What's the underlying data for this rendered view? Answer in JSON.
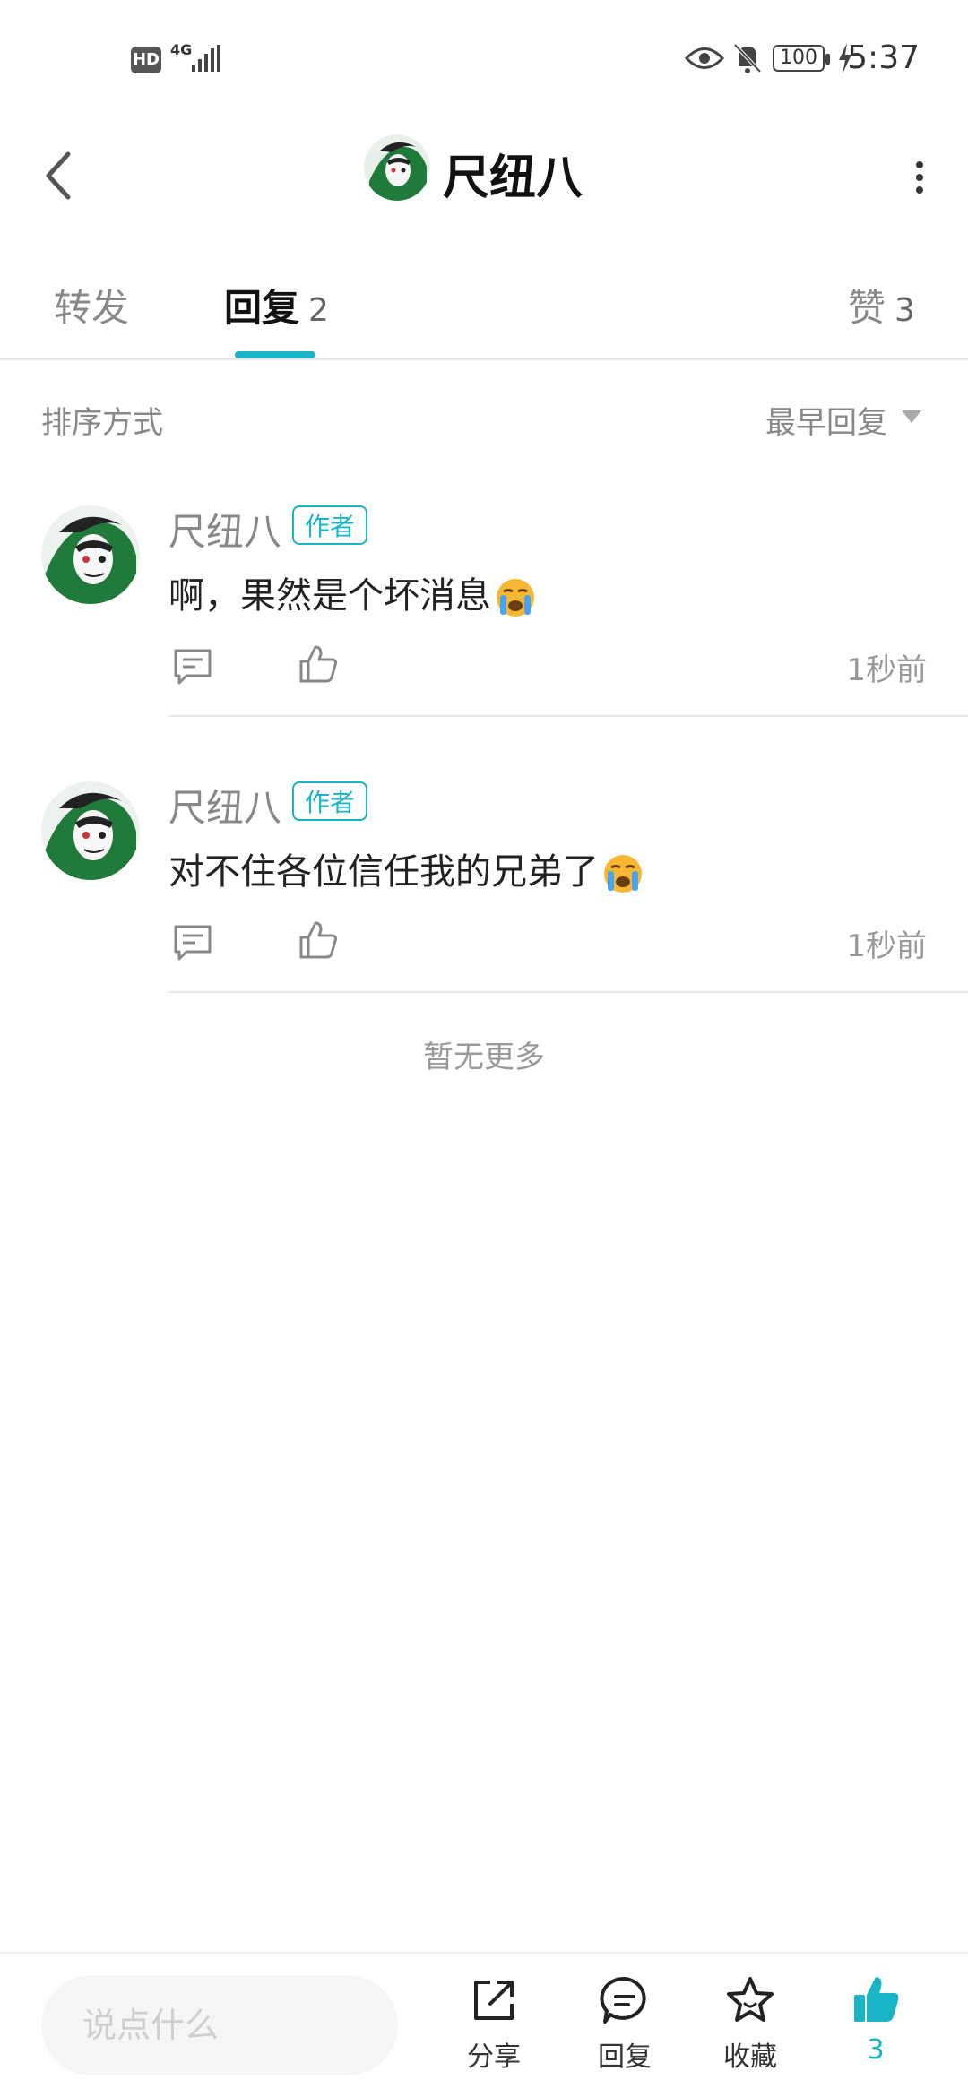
{
  "status_bar": {
    "hd": "HD",
    "network": "4G",
    "battery": "100",
    "time": "5:37"
  },
  "header": {
    "title": "尺纽八"
  },
  "tabs": [
    {
      "label": "转发",
      "count": ""
    },
    {
      "label": "回复",
      "count": "2"
    },
    {
      "label": "赞",
      "count": "3"
    }
  ],
  "sort": {
    "label": "排序方式",
    "value": "最早回复"
  },
  "replies": [
    {
      "name": "尺纽八",
      "badge": "作者",
      "text": "啊，果然是个坏消息",
      "emoji": "loudly-crying-face",
      "time": "1秒前"
    },
    {
      "name": "尺纽八",
      "badge": "作者",
      "text": "对不住各位信任我的兄弟了",
      "emoji": "loudly-crying-face",
      "time": "1秒前"
    }
  ],
  "no_more": "暂无更多",
  "bottom_bar": {
    "input_placeholder": "说点什么",
    "share_label": "分享",
    "reply_label": "回复",
    "favorite_label": "收藏",
    "like_count": "3"
  },
  "colors": {
    "accent": "#19b5c6",
    "text_primary": "#222222",
    "text_secondary": "#888888"
  }
}
